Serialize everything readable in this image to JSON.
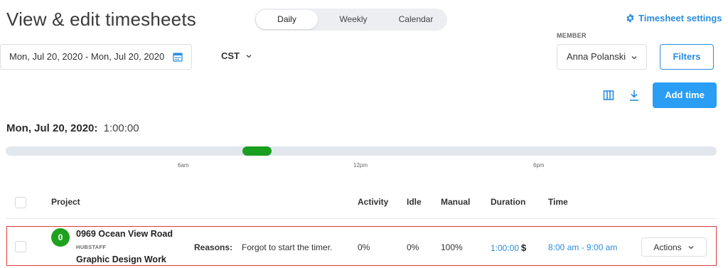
{
  "header": {
    "title": "View & edit timesheets",
    "views": [
      "Daily",
      "Weekly",
      "Calendar"
    ],
    "settings_label": "Timesheet settings"
  },
  "filters": {
    "date_range": "Mon, Jul 20, 2020 - Mon, Jul 20, 2020",
    "timezone": "CST",
    "member_label": "MEMBER",
    "member_value": "Anna Polanski",
    "filters_label": "Filters"
  },
  "toolbar": {
    "add_time_label": "Add time"
  },
  "day": {
    "date": "Mon, Jul 20, 2020:",
    "total": "1:00:00",
    "ticks": [
      "6am",
      "12pm",
      "6pm"
    ]
  },
  "table": {
    "headers": {
      "project": "Project",
      "activity": "Activity",
      "idle": "Idle",
      "manual": "Manual",
      "duration": "Duration",
      "time": "Time"
    },
    "rows": [
      {
        "avatar": "0",
        "project": "0969 Ocean View Road",
        "org": "HUBSTAFF",
        "task": "Graphic Design Work",
        "reasons_label": "Reasons:",
        "reason": "Forgot to start the timer.",
        "activity": "0%",
        "idle": "0%",
        "manual": "100%",
        "duration": "1:00:00",
        "currency": "$",
        "time": "8:00 am - 9:00 am",
        "actions_label": "Actions"
      }
    ]
  },
  "colors": {
    "accent": "#2a8de0",
    "timeline_fill": "#1a9e1f",
    "selected_row_border": "#e0383e"
  }
}
